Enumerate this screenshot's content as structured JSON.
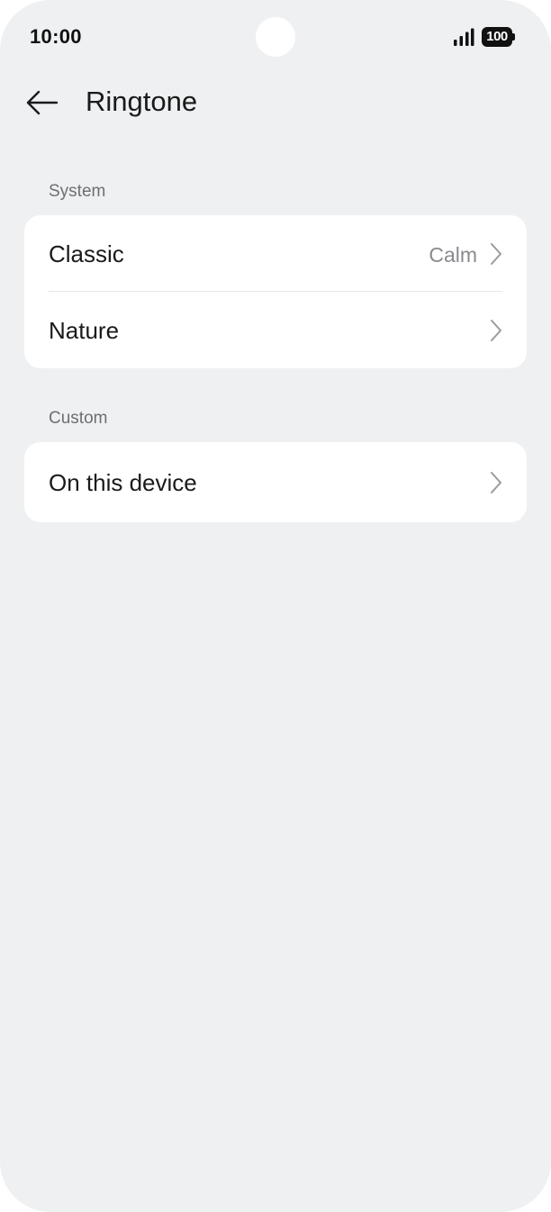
{
  "status_bar": {
    "time": "10:00",
    "battery": "100",
    "icons": [
      "signal-icon",
      "battery-icon"
    ]
  },
  "header": {
    "back_icon": "arrow-left-icon",
    "title": "Ringtone"
  },
  "sections": [
    {
      "label": "System",
      "items": [
        {
          "label": "Classic",
          "value": "Calm",
          "icon": "chevron-right-icon"
        },
        {
          "label": "Nature",
          "value": "",
          "icon": "chevron-right-icon"
        }
      ]
    },
    {
      "label": "Custom",
      "items": [
        {
          "label": "On this device",
          "value": "",
          "icon": "chevron-right-icon"
        }
      ]
    }
  ]
}
